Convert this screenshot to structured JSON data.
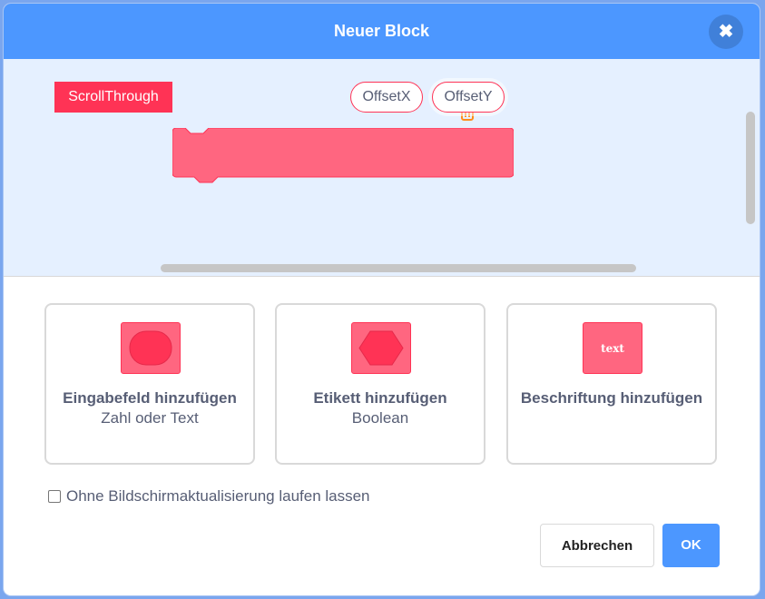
{
  "dialog": {
    "title": "Neuer Block",
    "close_icon": "close-icon"
  },
  "block": {
    "label": "ScrollThrough",
    "args": [
      "OffsetX",
      "OffsetY"
    ],
    "color": "#ff6680",
    "border_color": "#ff3355"
  },
  "options": [
    {
      "title": "Eingabefeld hinzufügen",
      "subtitle": "Zahl oder Text",
      "icon": "round-input-icon"
    },
    {
      "title": "Etikett hinzufügen",
      "subtitle": "Boolean",
      "icon": "boolean-input-icon"
    },
    {
      "title": "Beschriftung hinzufügen",
      "subtitle": "",
      "icon": "text-label-icon",
      "icon_text": "text"
    }
  ],
  "checkbox": {
    "label": "Ohne Bildschirmaktualisierung laufen lassen",
    "checked": false
  },
  "buttons": {
    "cancel": "Abbrechen",
    "ok": "OK"
  },
  "colors": {
    "header": "#4c97ff",
    "workspace": "#e5f0ff",
    "trash": "#ff8c1a"
  }
}
